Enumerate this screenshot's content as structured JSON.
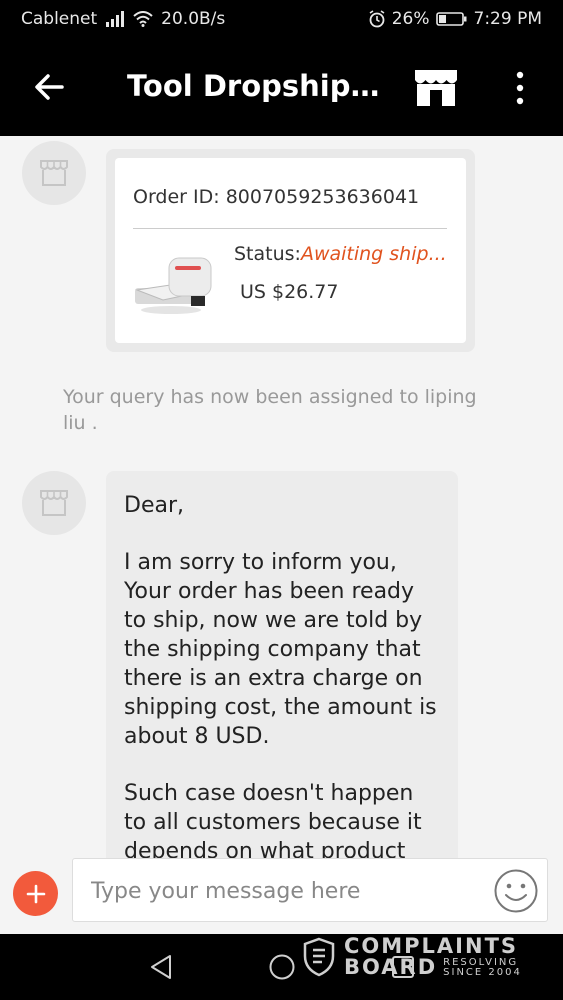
{
  "statusbar": {
    "carrier": "Cablenet",
    "speed": "20.0B/s",
    "battery": "26%",
    "time": "7:29 PM"
  },
  "header": {
    "title": "Tool Dropshippi...",
    "back_icon": "arrow-left-icon",
    "store_icon": "store-icon",
    "more_icon": "more-vertical-icon"
  },
  "order": {
    "id_text": "Order ID: 8007059253636041",
    "status_label": "Status:",
    "status_value": "Awaiting ship...",
    "price": "US $26.77"
  },
  "system_message": "Your query has now been assigned to liping liu .",
  "message": {
    "paragraphs": [
      "Dear,",
      "I am sorry to inform you, Your order has been ready to ship, now we are told by the shipping company that there is an extra charge on shipping cost, the amount is about 8 USD.",
      "Such case doesn't happen to all customers because it depends on what product"
    ]
  },
  "composer": {
    "placeholder": "Type your message here"
  },
  "watermark": {
    "line1": "COMPLAINTS",
    "line2": "BOARD",
    "tag1": "RESOLVING",
    "tag2": "SINCE 2004"
  },
  "colors": {
    "accent": "#f25a3c",
    "status": "#e0531f",
    "bar": "#000000"
  }
}
